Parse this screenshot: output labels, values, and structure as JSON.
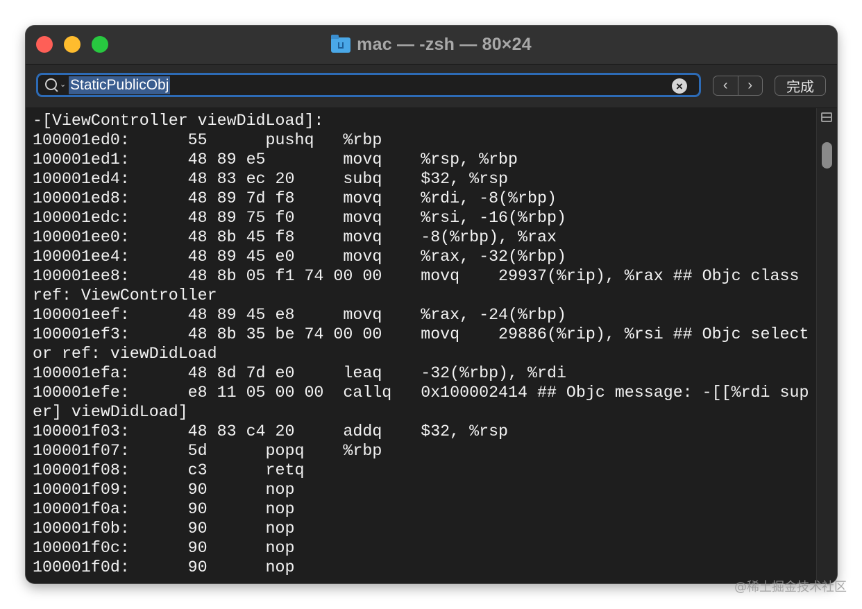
{
  "window": {
    "title": "mac — -zsh — 80×24",
    "title_icon": "home-folder-icon"
  },
  "findbar": {
    "search_value": "StaticPublicObj",
    "search_icon": "search-icon",
    "clear_icon": "clear-icon",
    "prev_icon": "chevron-left-icon",
    "next_icon": "chevron-right-icon",
    "prev_label": "‹",
    "next_label": "›",
    "clear_label": "×",
    "done_label": "完成"
  },
  "terminal": {
    "lines": [
      "-[ViewController viewDidLoad]:",
      "100001ed0:      55      pushq   %rbp",
      "100001ed1:      48 89 e5        movq    %rsp, %rbp",
      "100001ed4:      48 83 ec 20     subq    $32, %rsp",
      "100001ed8:      48 89 7d f8     movq    %rdi, -8(%rbp)",
      "100001edc:      48 89 75 f0     movq    %rsi, -16(%rbp)",
      "100001ee0:      48 8b 45 f8     movq    -8(%rbp), %rax",
      "100001ee4:      48 89 45 e0     movq    %rax, -32(%rbp)",
      "100001ee8:      48 8b 05 f1 74 00 00    movq    29937(%rip), %rax ## Objc class",
      "ref: ViewController",
      "100001eef:      48 89 45 e8     movq    %rax, -24(%rbp)",
      "100001ef3:      48 8b 35 be 74 00 00    movq    29886(%rip), %rsi ## Objc select",
      "or ref: viewDidLoad",
      "100001efa:      48 8d 7d e0     leaq    -32(%rbp), %rdi",
      "100001efe:      e8 11 05 00 00  callq   0x100002414 ## Objc message: -[[%rdi sup",
      "er] viewDidLoad]",
      "100001f03:      48 83 c4 20     addq    $32, %rsp",
      "100001f07:      5d      popq    %rbp",
      "100001f08:      c3      retq",
      "100001f09:      90      nop",
      "100001f0a:      90      nop",
      "100001f0b:      90      nop",
      "100001f0c:      90      nop",
      "100001f0d:      90      nop"
    ]
  },
  "watermark": "@稀土掘金技术社区",
  "colors": {
    "close": "#fe5f57",
    "minimize": "#febc2e",
    "zoom": "#28c840",
    "search_focus": "#2d6bb6",
    "selection": "#3a5d8f"
  }
}
